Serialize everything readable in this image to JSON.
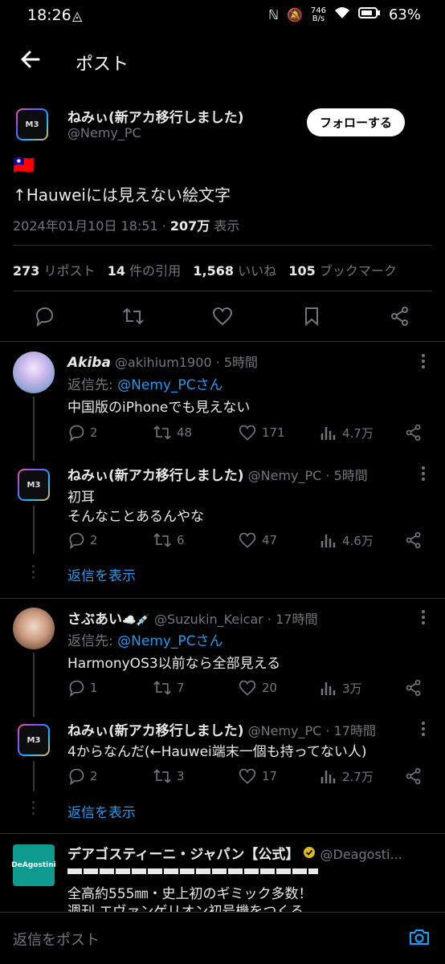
{
  "status": {
    "time": "18:26",
    "net_speed_top": "746",
    "net_speed_unit": "B/s",
    "battery": "63%"
  },
  "header": {
    "title": "ポスト"
  },
  "post": {
    "author_name": "ねみぃ(新アカ移行しました)",
    "author_handle": "@Nemy_PC",
    "avatar_label": "M3",
    "follow_label": "フォローする",
    "flag": "🇹🇼",
    "text": "↑Hauweiには見えない絵文字",
    "date": "2024年01月10日 18:51",
    "views": "207万",
    "views_label": "表示"
  },
  "stats": {
    "reposts_n": "273",
    "reposts_label": "リポスト",
    "quotes_n": "14",
    "quotes_label": "件の引用",
    "likes_n": "1,568",
    "likes_label": "いいね",
    "bookmarks_n": "105",
    "bookmarks_label": "ブックマーク"
  },
  "replies": [
    {
      "name": "Akiba",
      "handle": "@akihium1900",
      "time": "5時間",
      "reply_to_label": "返信先: ",
      "reply_to": "@Nemy_PCさん",
      "text": "中国版のiPhoneでも見えない",
      "replies": "2",
      "reposts": "48",
      "likes": "171",
      "views": "4.7万"
    },
    {
      "name": "ねみぃ(新アカ移行しました)",
      "handle": "@Nemy_PC",
      "time": "5時間",
      "text1": "初耳",
      "text2": "そんなことあるんやな",
      "replies": "2",
      "reposts": "6",
      "likes": "47",
      "views": "4.6万"
    },
    {
      "name": "さぶあい",
      "handle": "@Suzukin_Keicar",
      "time": "17時間",
      "reply_to_label": "返信先: ",
      "reply_to": "@Nemy_PCさん",
      "text": "HarmonyOS3以前なら全部見える",
      "replies": "1",
      "reposts": "7",
      "likes": "20",
      "views": "3万"
    },
    {
      "name": "ねみぃ(新アカ移行しました)",
      "handle": "@Nemy_PC",
      "time": "17時間",
      "text": "4からなんだ(←Hauwei端末一個も持ってない人)",
      "replies": "2",
      "reposts": "3",
      "likes": "17",
      "views": "2.7万"
    }
  ],
  "show_replies": "返信を表示",
  "ad": {
    "name": "デアゴスティーニ・ジャパン【公式】",
    "handle": "@Deagosti...",
    "logo_text": "DeAgostini",
    "line1": "全高約555㎜・史上初のギミック多数！",
    "line2": "週刊 エヴァンゲリオン初号機をつくる"
  },
  "compose": {
    "placeholder": "返信をポスト"
  }
}
